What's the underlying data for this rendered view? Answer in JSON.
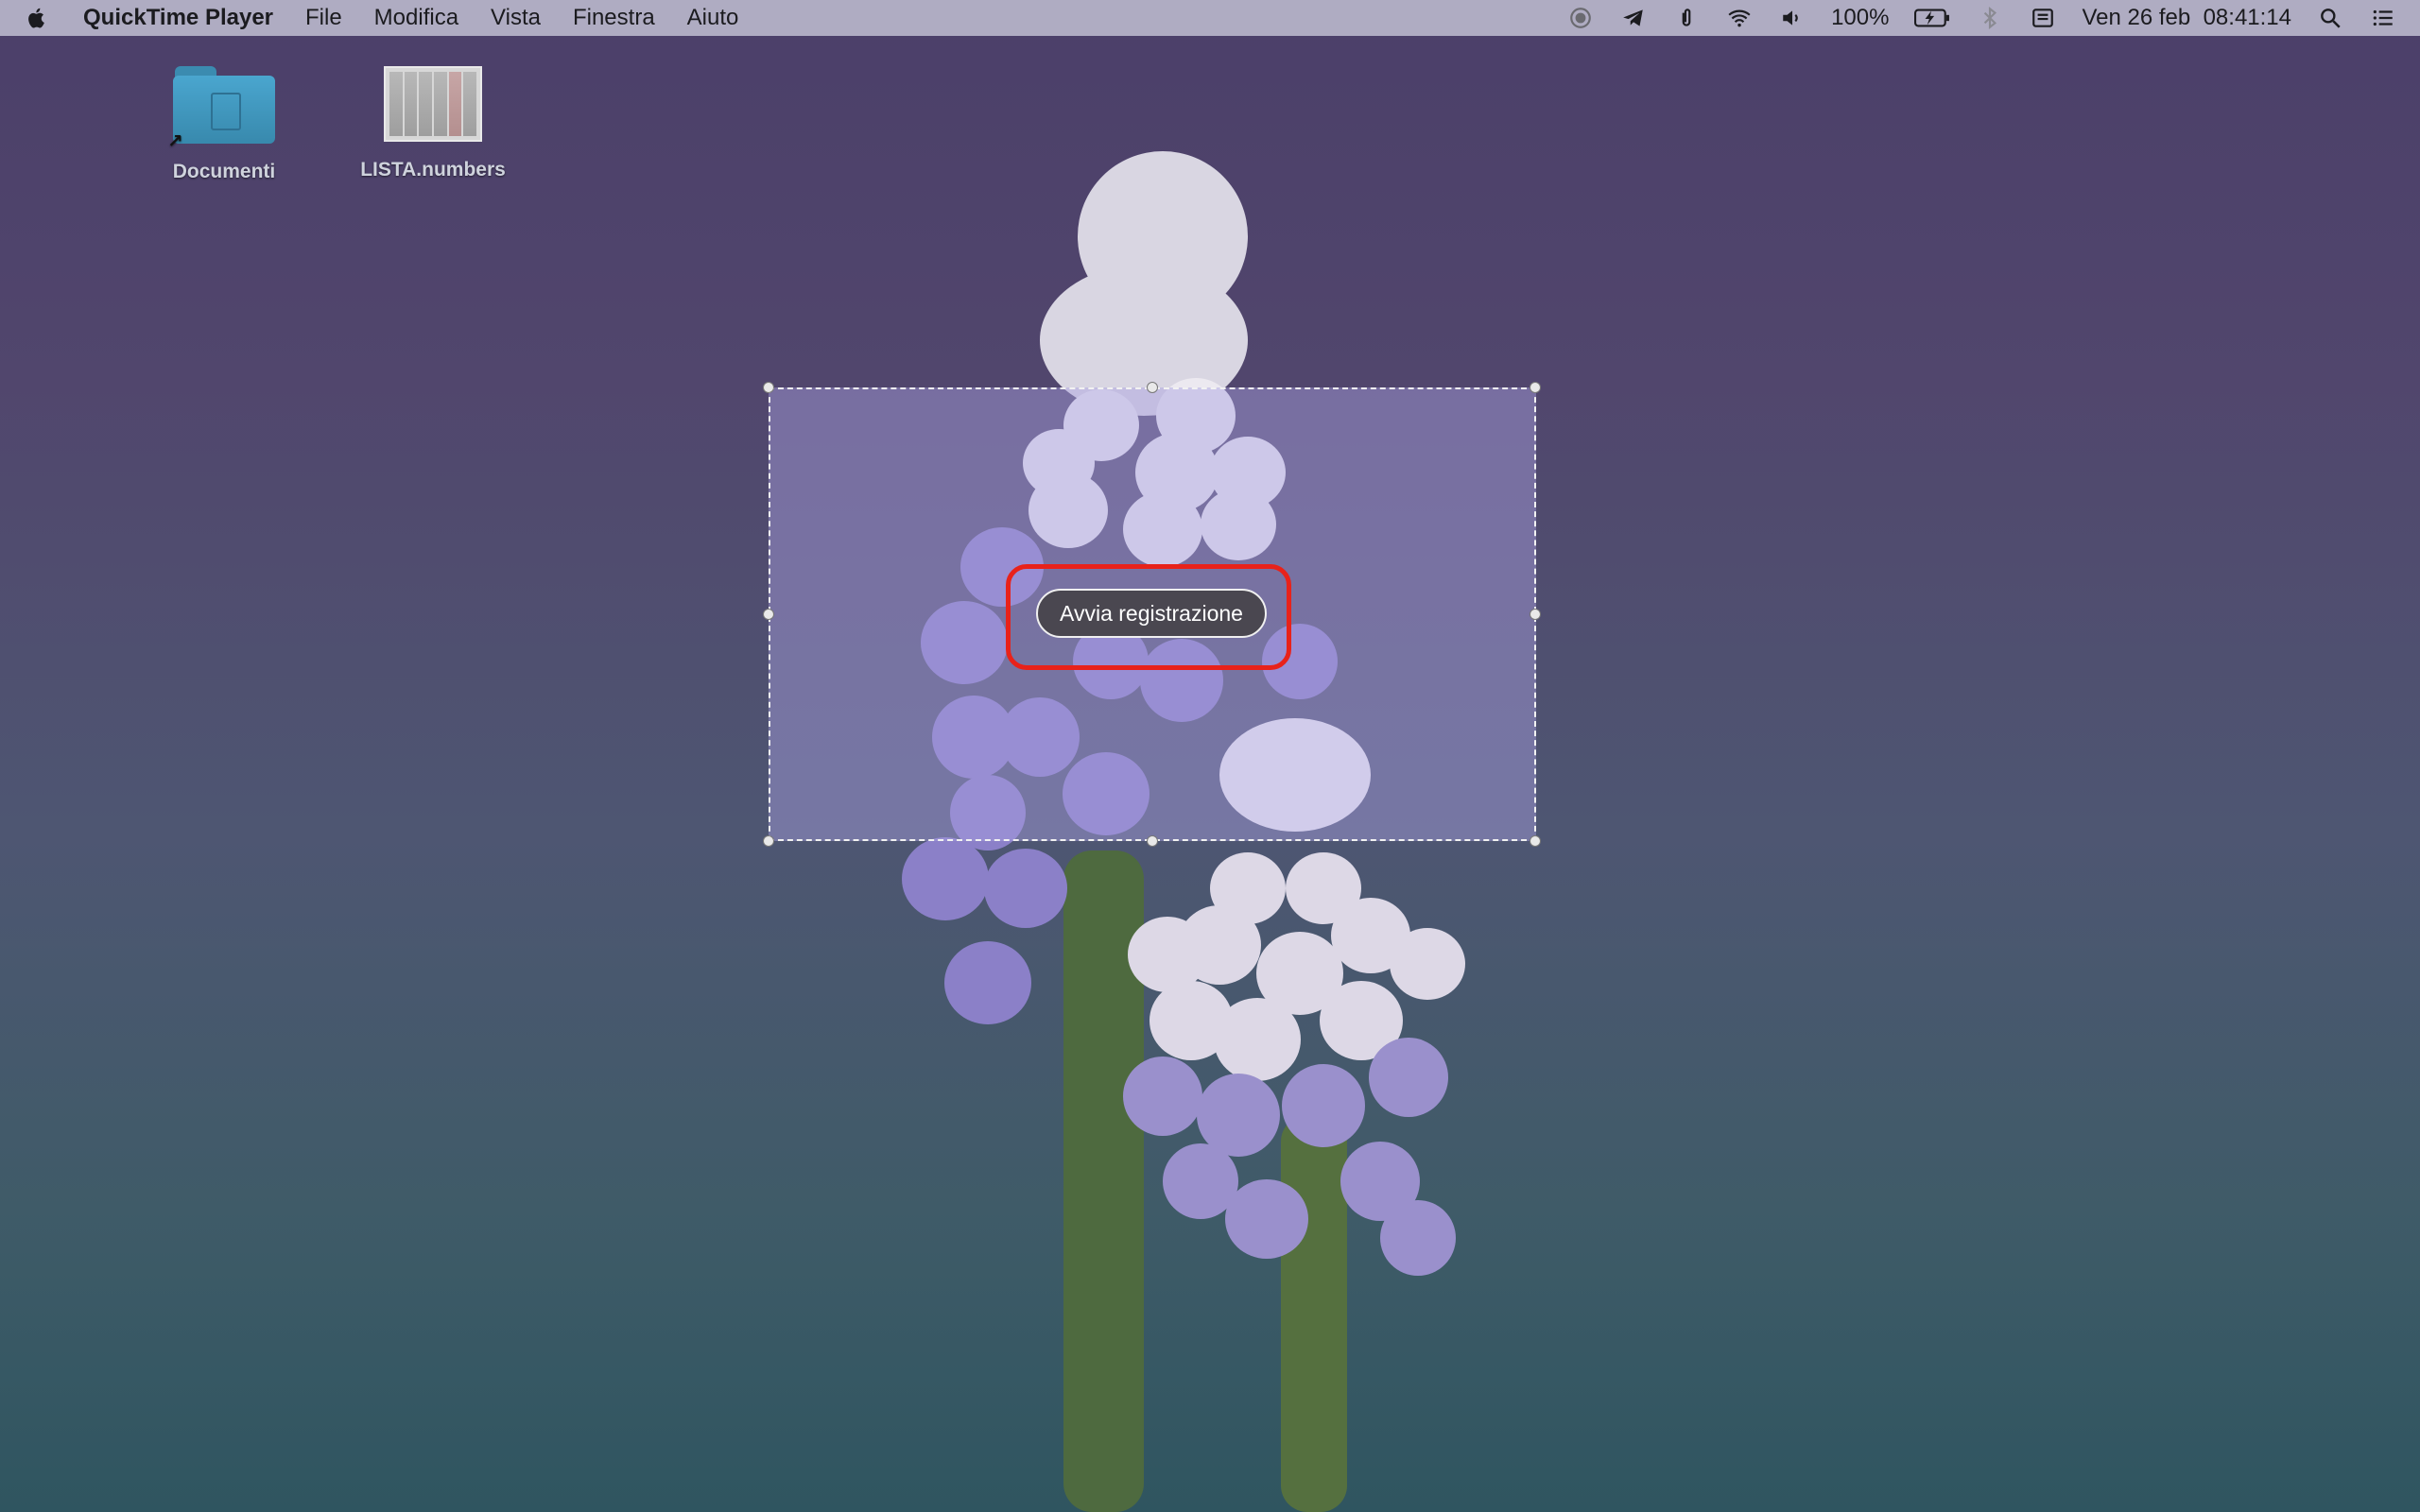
{
  "menubar": {
    "app_name": "QuickTime Player",
    "menus": [
      "File",
      "Modifica",
      "Vista",
      "Finestra",
      "Aiuto"
    ],
    "status_icons": [
      "screen-recording-icon",
      "telegram-icon",
      "paperclip-icon",
      "wifi-icon",
      "volume-icon"
    ],
    "battery": "100%",
    "datetime": "Ven 26 feb  08:41:14"
  },
  "desktop": {
    "icons": [
      {
        "label": "Documenti",
        "kind": "folder-alias"
      },
      {
        "label": "LISTA.numbers",
        "kind": "numbers-document"
      }
    ]
  },
  "recording": {
    "start_button_label": "Avvia registrazione"
  },
  "colors": {
    "highlight": "#e8221a",
    "selection_fill": "#a8a0e1",
    "button_bg": "#4a4750"
  }
}
